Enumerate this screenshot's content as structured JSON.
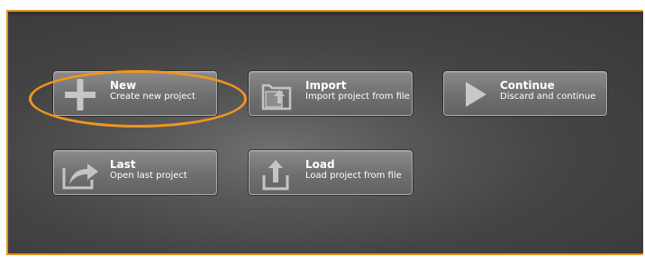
{
  "buttons": {
    "new": {
      "title": "New",
      "subtitle": "Create new project",
      "icon": "plus-icon"
    },
    "import": {
      "title": "Import",
      "subtitle": "Import project from file",
      "icon": "import-folder-icon"
    },
    "continue": {
      "title": "Continue",
      "subtitle": "Discard and continue",
      "icon": "play-icon"
    },
    "last": {
      "title": "Last",
      "subtitle": "Open last project",
      "icon": "open-last-arrow-icon"
    },
    "load": {
      "title": "Load",
      "subtitle": "Load project from file",
      "icon": "upload-tray-icon"
    }
  },
  "colors": {
    "accent": "#f0961e",
    "panel_border": "#e8951e",
    "button_text": "#ffffff",
    "icon": "#c4c4c4"
  }
}
